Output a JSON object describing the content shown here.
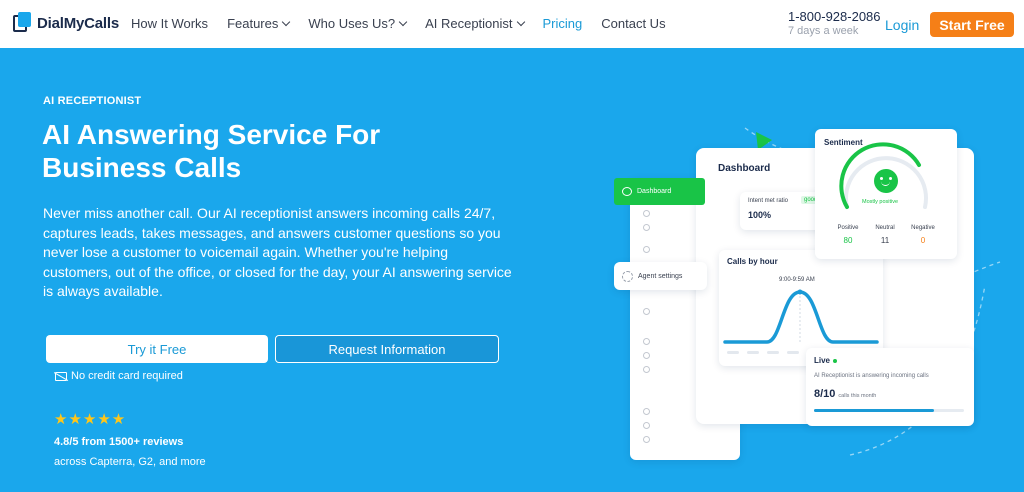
{
  "brand": {
    "name": "DialMyCalls"
  },
  "nav": {
    "items": [
      {
        "label": "How It Works",
        "dropdown": false
      },
      {
        "label": "Features",
        "dropdown": true
      },
      {
        "label": "Who Uses Us?",
        "dropdown": true
      },
      {
        "label": "AI Receptionist",
        "dropdown": true
      },
      {
        "label": "Pricing",
        "dropdown": false,
        "active": true
      },
      {
        "label": "Contact Us",
        "dropdown": false
      }
    ],
    "phone": "1-800-928-2086",
    "phone_hours": "7 days a week",
    "login": "Login",
    "cta": "Start Free"
  },
  "hero": {
    "eyebrow": "AI RECEPTIONIST",
    "title": "AI Answering Service For Business Calls",
    "description": "Never miss another call. Our AI receptionist answers incoming calls 24/7, captures leads, takes messages, and answers customer questions so you never lose a customer to voicemail again. Whether you're helping customers, out of the office, or closed for the day, your AI answering service is always available.",
    "primary_button": "Try it Free",
    "secondary_button": "Request Information",
    "no_credit_card": "No credit card required",
    "stars": "★★★★★",
    "rating": "4.8/5 from 1500+ reviews",
    "rating_sources": "across Capterra, G2, and more"
  },
  "illustration": {
    "dashboard_label": "Dashboard",
    "dashboard_title": "Dashboard",
    "agent_settings": "Agent settings",
    "intent_label": "Intent met ratio",
    "intent_tag": "good",
    "intent_value": "100%",
    "calls_title": "Calls by hour",
    "calls_range": "9:00-9:59 AM",
    "sentiment_title": "Sentiment",
    "sentiment_status": "Mostly positive",
    "sentiment": [
      {
        "label": "Positive",
        "value": "80",
        "color": "#19c447"
      },
      {
        "label": "Neutral",
        "value": "11",
        "color": "#3a4150"
      },
      {
        "label": "Negative",
        "value": "0",
        "color": "#f57f17"
      }
    ],
    "live_title": "Live",
    "live_desc": "AI Receptionist is answering incoming calls",
    "live_count": "8/10",
    "live_count_label": "calls this month",
    "live_progress": 0.8
  },
  "colors": {
    "brand_blue": "#1aa7ec",
    "accent_orange": "#f57f17",
    "green": "#19c447"
  }
}
